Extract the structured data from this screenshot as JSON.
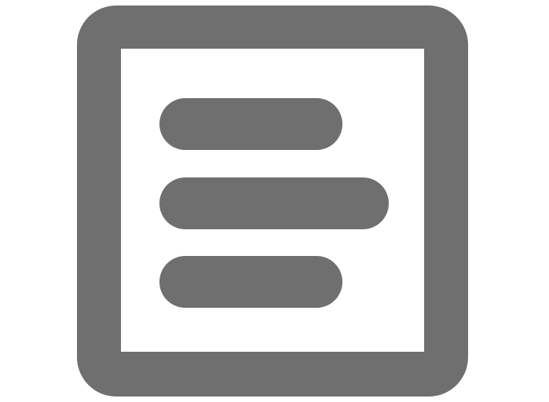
{
  "icon": {
    "name": "text-document-icon",
    "color": "#6f6f6f",
    "background": "#ffffff"
  }
}
